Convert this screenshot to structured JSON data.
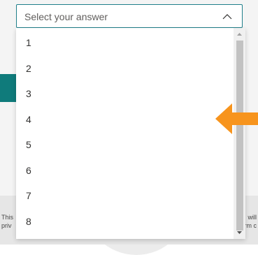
{
  "select": {
    "placeholder": "Select your answer",
    "expanded": true
  },
  "options": [
    "1",
    "2",
    "3",
    "4",
    "5",
    "6",
    "7",
    "8"
  ],
  "footer": {
    "line1_left": "This",
    "line1_right": "will",
    "line2_left": "priv",
    "line2_right": "rm c"
  },
  "colors": {
    "accent_border": "#1f7f8a",
    "teal_block": "#0f7b7b",
    "pointer_arrow": "#f7941d",
    "text": "#323130"
  },
  "icons": {
    "chevron": "chevron-up-icon",
    "pointer": "orange-arrow-left-icon",
    "scroll_up": "scroll-up-arrow-icon",
    "scroll_down": "scroll-down-arrow-icon"
  }
}
